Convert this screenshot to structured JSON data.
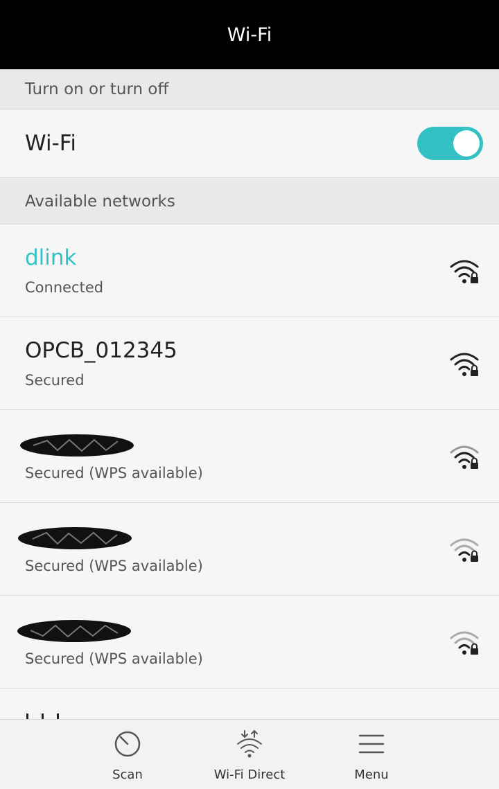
{
  "header": {
    "title": "Wi-Fi"
  },
  "toggle_section": {
    "label": "Turn on or turn off"
  },
  "wifi_toggle": {
    "label": "Wi-Fi",
    "state": "on",
    "accent_color": "#33c1c4"
  },
  "networks_section": {
    "label": "Available networks"
  },
  "networks": [
    {
      "name": "dlink",
      "status": "Connected",
      "signal_icon": "wifi-lock-icon",
      "connected": true
    },
    {
      "name": "OPCB_012345",
      "status": "Secured",
      "signal_icon": "wifi-lock-icon"
    },
    {
      "name": "",
      "status": "Secured (WPS available)",
      "signal_icon": "wifi-lock-icon",
      "redacted": true
    },
    {
      "name": "",
      "status": "Secured (WPS available)",
      "signal_icon": "wifi-lock-icon",
      "redacted": true
    },
    {
      "name": "",
      "status": "Secured (WPS available)",
      "signal_icon": "wifi-lock-icon",
      "redacted": true
    }
  ],
  "bottom_bar": {
    "scan": {
      "label": "Scan",
      "icon": "scan-icon"
    },
    "wifi_direct": {
      "label": "Wi-Fi Direct",
      "icon": "wifi-direct-icon"
    },
    "menu": {
      "label": "Menu",
      "icon": "menu-icon"
    }
  }
}
